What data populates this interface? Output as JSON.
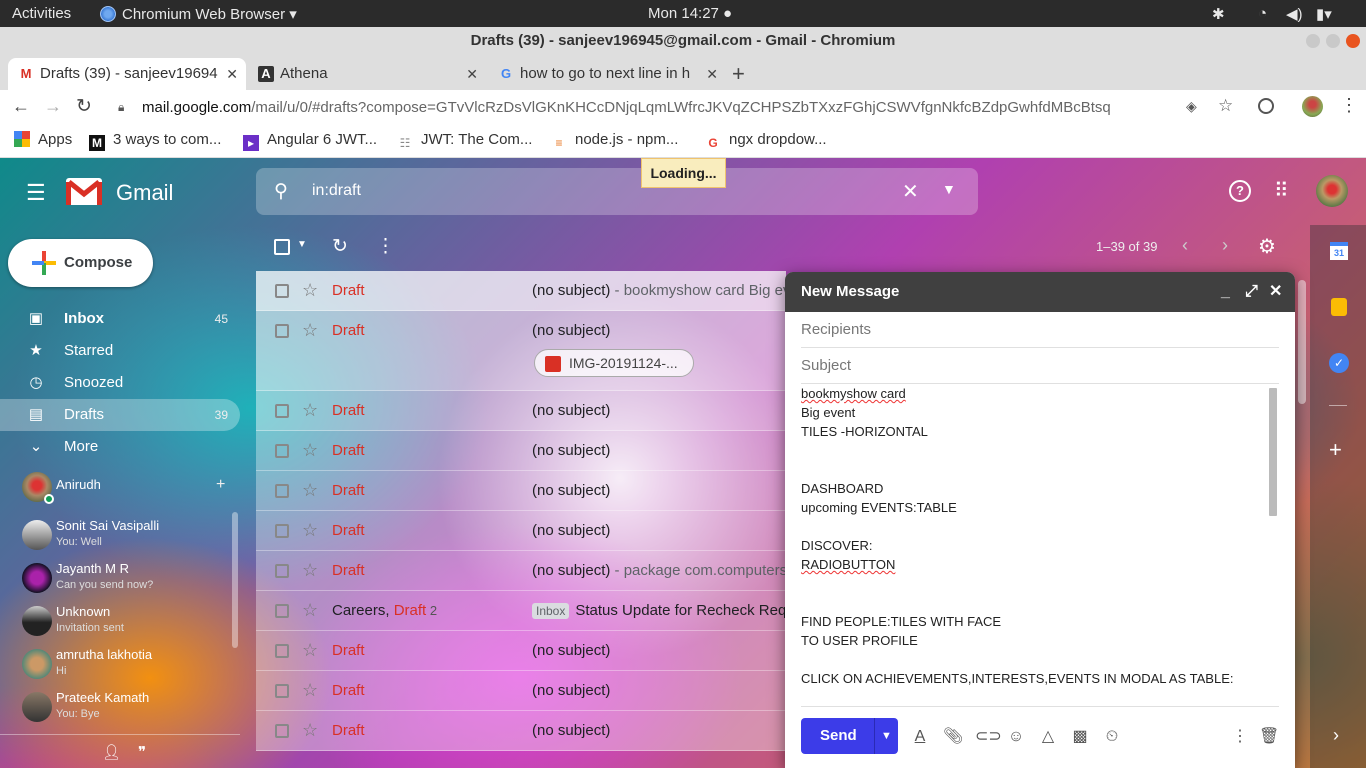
{
  "system": {
    "activities": "Activities",
    "app_name": "Chromium Web Browser",
    "clock": "Mon 14:27"
  },
  "window": {
    "title": "Drafts (39) - sanjeev196945@gmail.com - Gmail - Chromium"
  },
  "tabs": [
    {
      "label": "Drafts (39) - sanjeev19694",
      "icon": "gmail-icon"
    },
    {
      "label": "Athena",
      "icon": "angular-icon"
    },
    {
      "label": "how to go to next line in h",
      "icon": "google-icon"
    }
  ],
  "address": {
    "url_host": "mail.google.com",
    "url_path": "/mail/u/0/#drafts?compose=GTvVlcRzDsVlGKnKHCcDNjqLqmLWfrcJKVqZCHPSZbTXxzFGhjCSWVfgnNkfcBZdpGwhfdMBcBtsq"
  },
  "bookmarks": [
    {
      "label": "Apps"
    },
    {
      "label": "3 ways to com..."
    },
    {
      "label": "Angular 6 JWT..."
    },
    {
      "label": "JWT: The Com..."
    },
    {
      "label": "node.js - npm..."
    },
    {
      "label": "ngx dropdow..."
    }
  ],
  "gmail": {
    "logo_text": "Gmail",
    "search_value": "in:draft",
    "loading": "Loading...",
    "compose_label": "Compose",
    "pagination": "1–39 of 39"
  },
  "sidebar": {
    "items": [
      {
        "label": "Inbox",
        "count": "45"
      },
      {
        "label": "Starred",
        "count": ""
      },
      {
        "label": "Snoozed",
        "count": ""
      },
      {
        "label": "Drafts",
        "count": "39"
      },
      {
        "label": "More",
        "count": ""
      }
    ],
    "hangouts_user": "Anirudh",
    "contacts": [
      {
        "name": "Sonit Sai Vasipalli",
        "status": "You: Well"
      },
      {
        "name": "Jayanth M R",
        "status": "Can you send now?"
      },
      {
        "name": "Unknown",
        "status": "Invitation sent"
      },
      {
        "name": "amrutha lakhotia",
        "status": "Hi"
      },
      {
        "name": "Prateek Kamath",
        "status": "You: Bye"
      }
    ]
  },
  "emails": [
    {
      "sender": "Draft",
      "subject": "(no subject)",
      "snippet": " - bookmyshow card Big eve"
    },
    {
      "sender": "Draft",
      "subject": "(no subject)",
      "snippet": "",
      "attachment": "IMG-20191124-..."
    },
    {
      "sender": "Draft",
      "subject": "(no subject)",
      "snippet": ""
    },
    {
      "sender": "Draft",
      "subject": "(no subject)",
      "snippet": ""
    },
    {
      "sender": "Draft",
      "subject": "(no subject)",
      "snippet": ""
    },
    {
      "sender": "Draft",
      "subject": "(no subject)",
      "snippet": ""
    },
    {
      "sender": "Draft",
      "subject": "(no subject)",
      "snippet": " - package com.computersp"
    },
    {
      "sender_prefix": "Careers, ",
      "sender": "Draft",
      "sender_count": " 2",
      "label": "Inbox",
      "subject": "Status Update for Recheck Reque",
      "snippet": ""
    },
    {
      "sender": "Draft",
      "subject": "(no subject)",
      "snippet": ""
    },
    {
      "sender": "Draft",
      "subject": "(no subject)",
      "snippet": ""
    },
    {
      "sender": "Draft",
      "subject": "(no subject)",
      "snippet": ""
    }
  ],
  "compose_window": {
    "title": "New Message",
    "recipients_placeholder": "Recipients",
    "subject_placeholder": "Subject",
    "body_lines": [
      "bookmyshow card",
      "Big event",
      "TILES -HORIZONTAL",
      "",
      "",
      "DASHBOARD",
      "upcoming EVENTS:TABLE",
      "",
      "DISCOVER:",
      "RADIOBUTTON",
      "",
      "",
      "FIND PEOPLE:TILES WITH FACE",
      "TO USER PROFILE",
      "",
      "CLICK ON ACHIEVEMENTS,INTERESTS,EVENTS IN MODAL AS TABLE:"
    ],
    "send_label": "Send"
  },
  "rail": {
    "calendar_day": "31"
  }
}
